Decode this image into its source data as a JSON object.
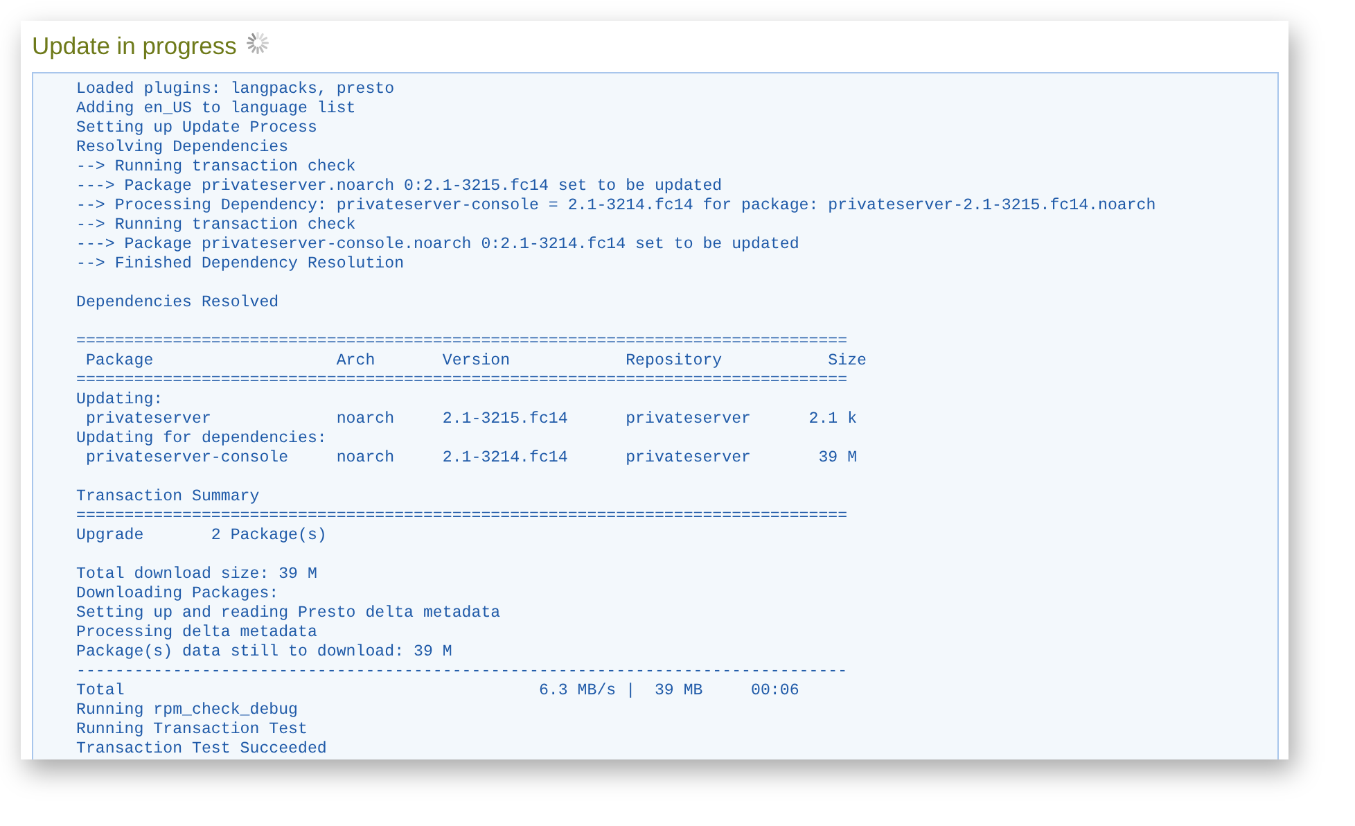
{
  "title": "Update in progress",
  "log": [
    {
      "lines": [
        "Loaded plugins: langpacks, presto",
        "Adding en_US to language list",
        "Setting up Update Process",
        "Resolving Dependencies",
        "--> Running transaction check",
        "---> Package privateserver.noarch 0:2.1-3215.fc14 set to be updated",
        "--> Processing Dependency: privateserver-console = 2.1-3214.fc14 for package: privateserver-2.1-3215.fc14.noarch",
        "--> Running transaction check",
        "---> Package privateserver-console.noarch 0:2.1-3214.fc14 set to be updated",
        "--> Finished Dependency Resolution"
      ]
    },
    {
      "lines": [
        "Dependencies Resolved"
      ]
    },
    {
      "lines": [
        "================================================================================",
        " Package                   Arch       Version            Repository           Size",
        "================================================================================",
        "Updating:",
        " privateserver             noarch     2.1-3215.fc14      privateserver      2.1 k",
        "Updating for dependencies:",
        " privateserver-console     noarch     2.1-3214.fc14      privateserver       39 M"
      ]
    },
    {
      "lines": [
        "Transaction Summary",
        "================================================================================",
        "Upgrade       2 Package(s)"
      ]
    },
    {
      "lines": [
        "Total download size: 39 M",
        "Downloading Packages:",
        "Setting up and reading Presto delta metadata",
        "Processing delta metadata",
        "Package(s) data still to download: 39 M",
        "--------------------------------------------------------------------------------",
        "Total                                           6.3 MB/s |  39 MB     00:06",
        "Running rpm_check_debug",
        "Running Transaction Test",
        "Transaction Test Succeeded"
      ]
    }
  ]
}
